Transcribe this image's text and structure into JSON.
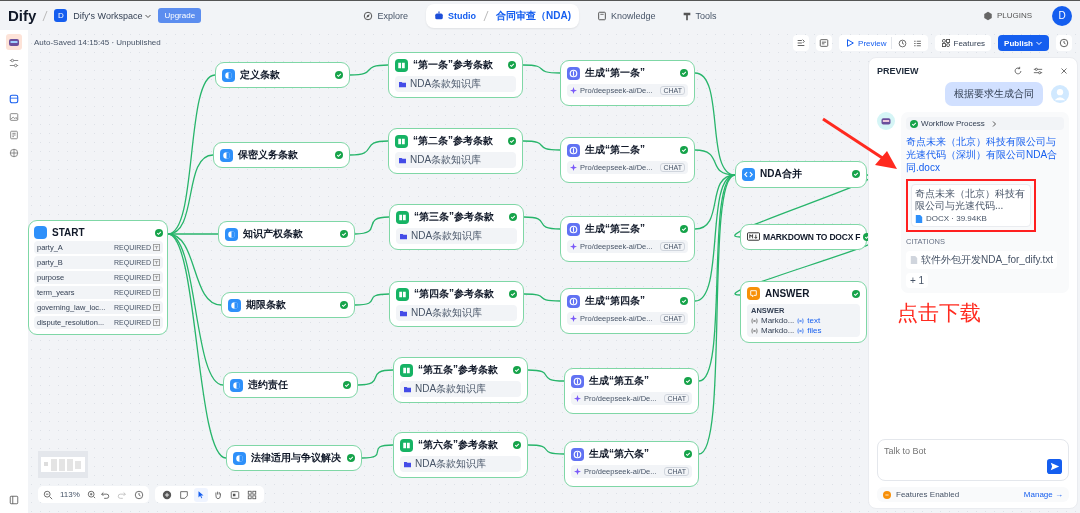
{
  "header": {
    "logo": "Dify",
    "workspace": {
      "initial": "D",
      "name": "Dify's Workspace"
    },
    "upgrade": "Upgrade",
    "nav": [
      {
        "kind": "explore",
        "label": "Explore",
        "selected": false
      },
      {
        "kind": "studio",
        "label": "Studio",
        "app": "合同审查（NDA)",
        "selected": true
      },
      {
        "kind": "knowledge",
        "label": "Knowledge",
        "selected": false
      },
      {
        "kind": "tools",
        "label": "Tools",
        "selected": false
      }
    ],
    "plugins": "PLUGINS",
    "avatar": "D"
  },
  "status": "Auto-Saved 14:15:45 · Unpublished",
  "toolbar": {
    "preview": "Preview",
    "features": "Features",
    "publish": "Publish"
  },
  "start": {
    "title": "START",
    "succeeded": true,
    "variables": [
      {
        "name": "party_A",
        "tag": "REQUIRED"
      },
      {
        "name": "party_B",
        "tag": "REQUIRED"
      },
      {
        "name": "purpose",
        "tag": "REQUIRED"
      },
      {
        "name": "term_years",
        "tag": "REQUIRED"
      },
      {
        "name": "governing_law_loc...",
        "tag": "REQUIRED"
      },
      {
        "name": "dispute_resolution...",
        "tag": "REQUIRED"
      }
    ]
  },
  "clauses": [
    {
      "title": "定义条款",
      "succeeded": true
    },
    {
      "title": "保密义务条款",
      "succeeded": true
    },
    {
      "title": "知识产权条款",
      "succeeded": true
    },
    {
      "title": "期限条款",
      "succeeded": true
    },
    {
      "title": "违约责任",
      "succeeded": true
    },
    {
      "title": "法律适用与争议解决",
      "succeeded": true
    }
  ],
  "knowledge": [
    {
      "title": "“第一条”参考条款",
      "source": "NDA条款知识库",
      "succeeded": true
    },
    {
      "title": "“第二条”参考条款",
      "source": "NDA条款知识库",
      "succeeded": true
    },
    {
      "title": "“第三条”参考条款",
      "source": "NDA条款知识库",
      "succeeded": true
    },
    {
      "title": "“第四条”参考条款",
      "source": "NDA条款知识库",
      "succeeded": true
    },
    {
      "title": "“第五条”参考条款",
      "source": "NDA条款知识库",
      "succeeded": true
    },
    {
      "title": "“第六条”参考条款",
      "source": "NDA条款知识库",
      "succeeded": true
    }
  ],
  "llm": [
    {
      "title": "生成“第一条”",
      "model": "Pro/deepseek-ai/De...",
      "tag": "CHAT",
      "succeeded": true
    },
    {
      "title": "生成“第二条”",
      "model": "Pro/deepseek-ai/De...",
      "tag": "CHAT",
      "succeeded": true
    },
    {
      "title": "生成“第三条”",
      "model": "Pro/deepseek-ai/De...",
      "tag": "CHAT",
      "succeeded": true
    },
    {
      "title": "生成“第四条”",
      "model": "Pro/deepseek-ai/De...",
      "tag": "CHAT",
      "succeeded": true
    },
    {
      "title": "生成“第五条”",
      "model": "Pro/deepseek-ai/De...",
      "tag": "CHAT",
      "succeeded": true
    },
    {
      "title": "生成“第六条”",
      "model": "Pro/deepseek-ai/De...",
      "tag": "CHAT",
      "succeeded": true
    }
  ],
  "merge": {
    "title": "NDA合并",
    "succeeded": true
  },
  "docx": {
    "title": "MARKDOWN TO DOCX F",
    "succeeded": true
  },
  "answer": {
    "title": "ANSWER",
    "succeeded": true,
    "label": "ANSWER",
    "outputs": [
      {
        "source": "Markdo...",
        "field": "text"
      },
      {
        "source": "Markdo...",
        "field": "files"
      }
    ]
  },
  "canvas_tools": [
    {
      "kind": "add",
      "selected": false
    },
    {
      "kind": "note",
      "selected": false
    },
    {
      "kind": "pointer",
      "selected": true
    },
    {
      "kind": "hand",
      "selected": false
    },
    {
      "kind": "image",
      "selected": false
    },
    {
      "kind": "layout",
      "selected": false
    }
  ],
  "zoom": "113%",
  "preview": {
    "title": "PREVIEW",
    "user_message": "根据要求生成合同",
    "workflow": "Workflow Process",
    "file_link": "奇点未来（北京）科技有限公司与光速代码（深圳）有限公司NDA合同.docx",
    "file_name": "奇点未来（北京）科技有限公司与光速代码...",
    "file_meta": "DOCX · 39.94KB",
    "citations_label": "CITATIONS",
    "citation": "软件外包开发NDA_for_dify.txt",
    "citation_more": "+ 1",
    "input_placeholder": "Talk to Bot",
    "features": "Features Enabled",
    "manage": "Manage →"
  },
  "annotation": {
    "text": "点击下载"
  }
}
